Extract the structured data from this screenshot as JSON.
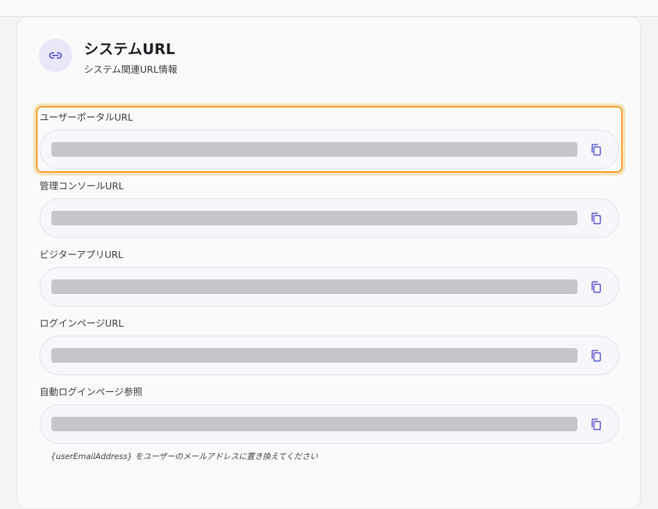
{
  "header": {
    "icon": "link-icon",
    "title": "システムURL",
    "subtitle": "システム関連URL情報"
  },
  "colors": {
    "accent": "#5b5bd6",
    "highlight": "#f29a1c",
    "redacted": "#c6c5cb"
  },
  "fields": [
    {
      "label": "ユーザーポータルURL",
      "value": "",
      "copy_icon": "copy-icon"
    },
    {
      "label": "管理コンソールURL",
      "value": "",
      "copy_icon": "copy-icon"
    },
    {
      "label": "ビジターアプリURL",
      "value": "",
      "copy_icon": "copy-icon"
    },
    {
      "label": "ログインページURL",
      "value": "",
      "copy_icon": "copy-icon"
    },
    {
      "label": "自動ログインページ参照",
      "value": "",
      "copy_icon": "copy-icon"
    }
  ],
  "hint": "{userEmailAddress} をユーザーのメールアドレスに置き換えてください"
}
